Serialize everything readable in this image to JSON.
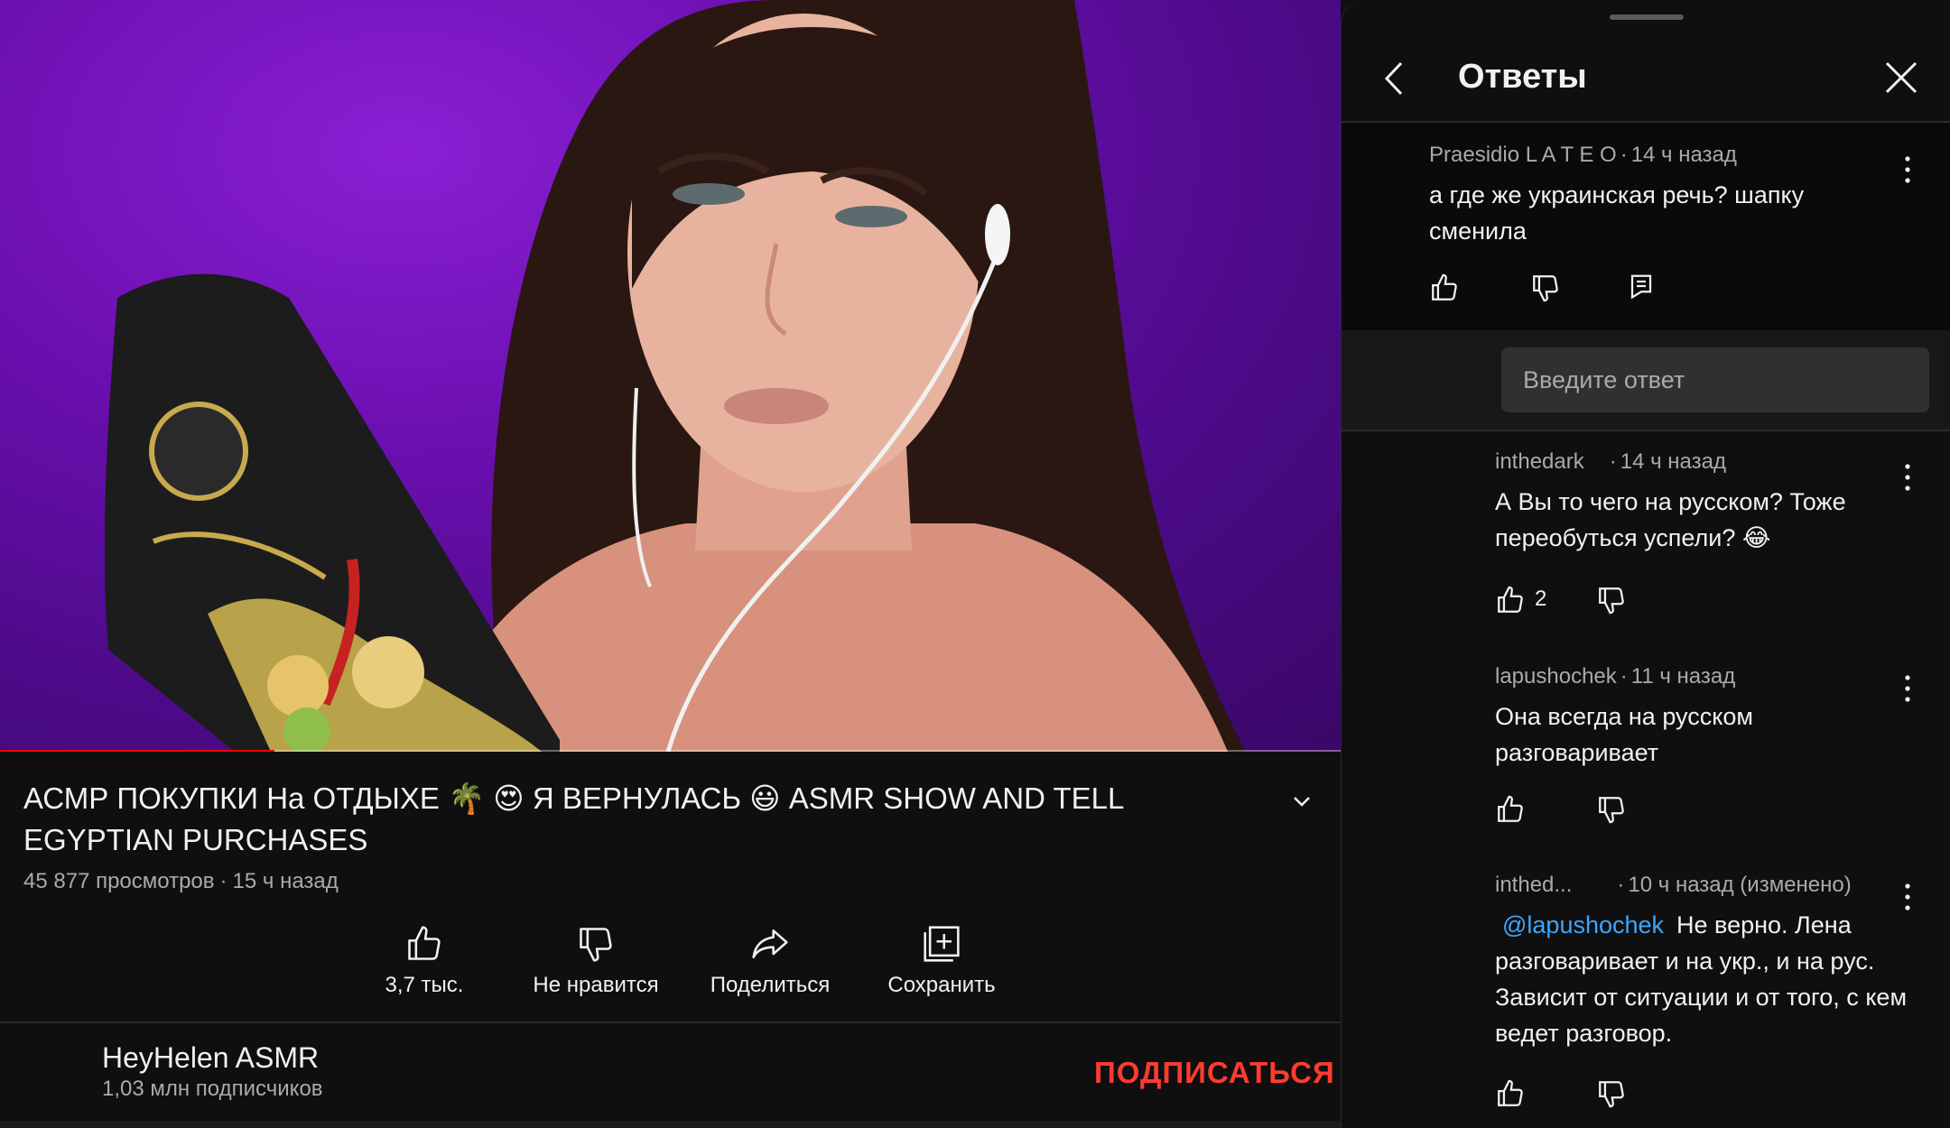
{
  "video": {
    "title": "АСМР ПОКУПКИ На ОТДЫХЕ 🌴 😍 Я ВЕРНУЛАСЬ 😃 ASMR SHOW AND TELL EGYPTIAN PURCHASES",
    "views": "45 877 просмотров",
    "separator": "·",
    "age": "15 ч назад",
    "progress_fraction": 0.205,
    "actions": {
      "like": "3,7 тыс.",
      "dislike": "Не нравится",
      "share": "Поделиться",
      "save": "Сохранить"
    }
  },
  "channel": {
    "name": "HeyHelen ASMR",
    "subscribers": "1,03 млн подписчиков",
    "subscribe_label": "ПОДПИСАТЬСЯ"
  },
  "panel": {
    "title": "Ответы",
    "reply_placeholder": "Введите ответ",
    "parent": {
      "author": "Praesidio L A T E O",
      "age": "14 ч назад",
      "text": "а где же украинская речь? шапку сменила"
    },
    "replies": [
      {
        "author": "inthedark",
        "age": "14 ч назад",
        "text": "А Вы то чего на русском? Тоже переобуться успели? 😂",
        "likes": "2"
      },
      {
        "author": "lapushochek",
        "age": "11 ч назад",
        "text": "Она всегда на русском разговаривает",
        "likes": ""
      },
      {
        "author": "inthed...",
        "age": "10 ч назад (изменено)",
        "mention": "@lapushochek",
        "text": "Не верно. Лена разговаривает и на укр., и на рус. Зависит от ситуации и от того, с кем ведет разговор.",
        "likes": ""
      }
    ]
  },
  "colors": {
    "background": "#0f0f0f",
    "accent_red": "#ff0000",
    "subscribe": "#ff3b30",
    "mention": "#3ea6ff",
    "video_bg": "#6b0fb0"
  },
  "icons": [
    "back-arrow-icon",
    "close-icon",
    "kebab-menu-icon",
    "thumb-up-icon",
    "thumb-down-icon",
    "reply-icon",
    "share-icon",
    "save-playlist-icon",
    "chevron-down-icon"
  ]
}
